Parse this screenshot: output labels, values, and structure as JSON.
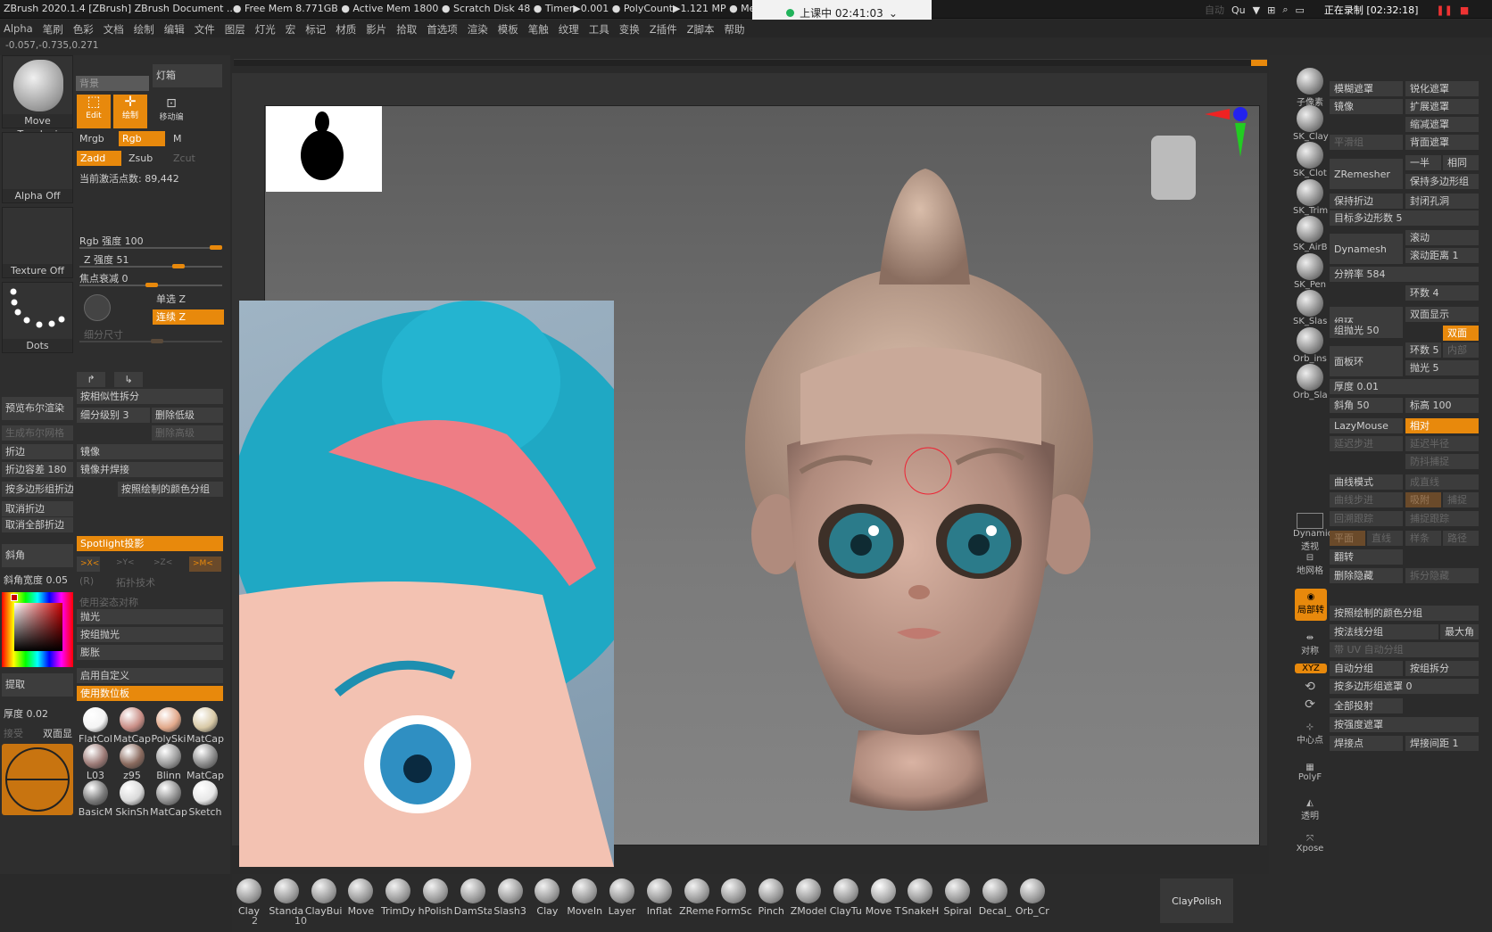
{
  "titlebar": {
    "title": "ZBrush 2020.1.4 [ZBrush]  ZBrush Document  ..● Free Mem 8.771GB ● Active Mem 1800 ● Scratch Disk 48 ● Timer▶0.001 ● PolyCount▶1.121 MP ● MeshCount▶",
    "auto": "自动",
    "qu": "Qu",
    "recording": "正在录制 [02:32:18]",
    "stop": "❚❚"
  },
  "class_timer": {
    "label": "上课中 02:41:03",
    "chevron": "⌄"
  },
  "menu": [
    "Alpha",
    "笔刷",
    "色彩",
    "文档",
    "绘制",
    "编辑",
    "文件",
    "图层",
    "灯光",
    "宏",
    "标记",
    "材质",
    "影片",
    "拾取",
    "首选项",
    "渲染",
    "模板",
    "笔触",
    "纹理",
    "工具",
    "变换",
    "Z插件",
    "Z脚本",
    "帮助"
  ],
  "coords": "-0.057,-0.735,0.271",
  "left": {
    "tool_name": "Move Topologi",
    "background_btn": "背景",
    "lightbox": "灯箱",
    "edit": "Edit",
    "draw": "绘制",
    "move_label": "移动编",
    "alpha": "Alpha Off",
    "texture": "Texture Off",
    "dots": "Dots",
    "mrgb": "Mrgb",
    "rgb": "Rgb",
    "m": "M",
    "zadd": "Zadd",
    "zsub": "Zsub",
    "zcut": "Zcut",
    "active_points": "当前激活点数: 89,442",
    "rgb_intensity": "Rgb 强度 100",
    "z_intensity": "Z 强度 51",
    "focal_shift": "焦点衰减 0",
    "single_z": "单选 Z",
    "continuous_z": "连续 Z",
    "subdiv_size": "细分尺寸",
    "preview_bool": "预览布尔渲染",
    "split_similar": "按相似性拆分",
    "subdiv_level": "细分级别 3",
    "delete_lower": "删除低级",
    "gen_bool_mesh": "生成布尔网格",
    "delete_higher": "删除高级",
    "crease": "折边",
    "mirror": "镜像",
    "crease_tol": "折边容差 180",
    "mirror_weld": "镜像并焊接",
    "crease_pg": "按多边形组折边",
    "split_by_color": "按照绘制的颜色分组",
    "uncrease": "取消折边",
    "uncrease_all": "取消全部折边",
    "bevel": "斜角",
    "spotlight": "Spotlight投影",
    "bevel_width": "斜角宽度 0.05",
    "xaxis": ">X<",
    "yaxis": ">Y<",
    "zaxis": ">Z<",
    "maxis": ">M<",
    "r": "(R)",
    "use_pose_sym": "使用姿态对称",
    "polish": "抛光",
    "group_polish": "按组抛光",
    "inflate": "膨胀",
    "enable_custom": "启用自定义",
    "use_posable": "使用数位板",
    "extract": "提取",
    "thickness": "厚度 0.02",
    "accept": "接受",
    "double": "双面显",
    "topo_tech": "拓扑技术",
    "xyz": "X Y Z"
  },
  "materials": [
    {
      "name": "FlatCol",
      "color": "#f4f4f4"
    },
    {
      "name": "MatCap",
      "color": "#c98e86"
    },
    {
      "name": "PolySki",
      "color": "#e1a88a"
    },
    {
      "name": "MatCap",
      "color": "#d8c9a6"
    },
    {
      "name": "L03",
      "color": "#9c7a76"
    },
    {
      "name": "z95",
      "color": "#8a6a5e"
    },
    {
      "name": "Blinn",
      "color": "#9a9a9a"
    },
    {
      "name": "MatCap",
      "color": "#8a8a8a"
    },
    {
      "name": "BasicM",
      "color": "#7a7a7a"
    },
    {
      "name": "SkinSh",
      "color": "#d9d9d9"
    },
    {
      "name": "MatCap",
      "color": "#8f8f8f"
    },
    {
      "name": "Sketch",
      "color": "#e6e6e6"
    }
  ],
  "right_icons": [
    {
      "name": "BPR",
      "label": "子像素"
    },
    {
      "name": "SK_Clay",
      "label": "SK_Clay"
    },
    {
      "name": "SK_Clot",
      "label": "SK_Clot"
    },
    {
      "name": "SK_Trim",
      "label": "SK_Trim"
    },
    {
      "name": "SK_AirB",
      "label": "SK_AirB"
    },
    {
      "name": "SK_Pen",
      "label": "SK_Pen"
    },
    {
      "name": "SK_Slas",
      "label": "SK_Slas"
    },
    {
      "name": "Orb_ins",
      "label": "Orb_ins"
    },
    {
      "name": "Orb_Sla",
      "label": "Orb_Sla"
    }
  ],
  "right_tools": {
    "dynamic": "Dynamic 透视",
    "floor": "地网格",
    "local": "局部转",
    "sym": "对称",
    "xyz": "XYZ",
    "center": "中心点",
    "polyf": "PolyF",
    "transp": "透明",
    "xpose": "Xpose"
  },
  "right": {
    "blur_mask": "模糊遮罩",
    "sharpen_mask": "锐化遮罩",
    "mirror": "镜像",
    "grow_mask": "扩展遮罩",
    "shrink_mask": "缩减遮罩",
    "smooth_group": "平滑组",
    "back_mask": "背面遮罩",
    "zremesher": "ZRemesher",
    "half": "一半",
    "same": "相同",
    "keep_groups": "保持多边形组",
    "keep_creases": "保持折边",
    "close_holes": "封闭孔洞",
    "target_poly": "目标多边形数 5",
    "dynamesh": "Dynamesh",
    "scroll": "滚动",
    "scroll_dist": "滚动距离 1",
    "resolution": "分辨率 584",
    "loops": "组环",
    "loop_count": "环数 4",
    "double_display": "双面显示",
    "group_polish": "组抛光 50",
    "double": "双面",
    "panel_loops": "面板环",
    "loops2": "环数 5",
    "inner": "内部",
    "polish": "抛光 5",
    "thickness": "厚度 0.01",
    "bevel": "斜角 50",
    "elevation": "标高 100",
    "lazymouse": "LazyMouse",
    "relative": "相对",
    "lazy_step": "延迟步进",
    "lazy_radius": "延迟半径",
    "backtrack": "防抖捕捉",
    "curve_mode": "曲线模式",
    "as_line": "成直线",
    "curve_step": "曲线步进",
    "snap": "吸附",
    "capture": "捕捉",
    "curve_follow": "回溯跟踪",
    "capture_follow": "捕捉跟踪",
    "plane": "平面",
    "line": "直线",
    "spline": "样条",
    "path": "路径",
    "flip": "翻转",
    "delete_hidden": "删除隐藏",
    "split_hidden": "拆分隐藏",
    "group_by_color": "按照绘制的颜色分组",
    "group_by_normals": "按法线分组",
    "max_angle": "最大角",
    "uv_group": "带 UV 自动分组",
    "auto_group": "自动分组",
    "split_groups": "按组拆分",
    "pg_mask": "按多边形组遮罩 0",
    "project_all": "全部投射",
    "intensity_mask": "按强度遮罩",
    "weld_points": "焊接点",
    "weld_dist": "焊接间距 1"
  },
  "brushes": [
    "Clay",
    "Standa",
    "ClayBui",
    "Move",
    "TrimDy",
    "hPolish",
    "DamSta",
    "Slash3",
    "Clay",
    "MoveIn",
    "Layer",
    "Inflat",
    "ZReme",
    "FormSc",
    "Pinch",
    "ZModel",
    "ClayTu",
    "Move T",
    "SnakeH",
    "Spiral",
    "Decal_",
    "Orb_Cr"
  ],
  "claypolish": "ClayPolish",
  "stroke_nums": {
    "a": "2",
    "b": "10"
  }
}
